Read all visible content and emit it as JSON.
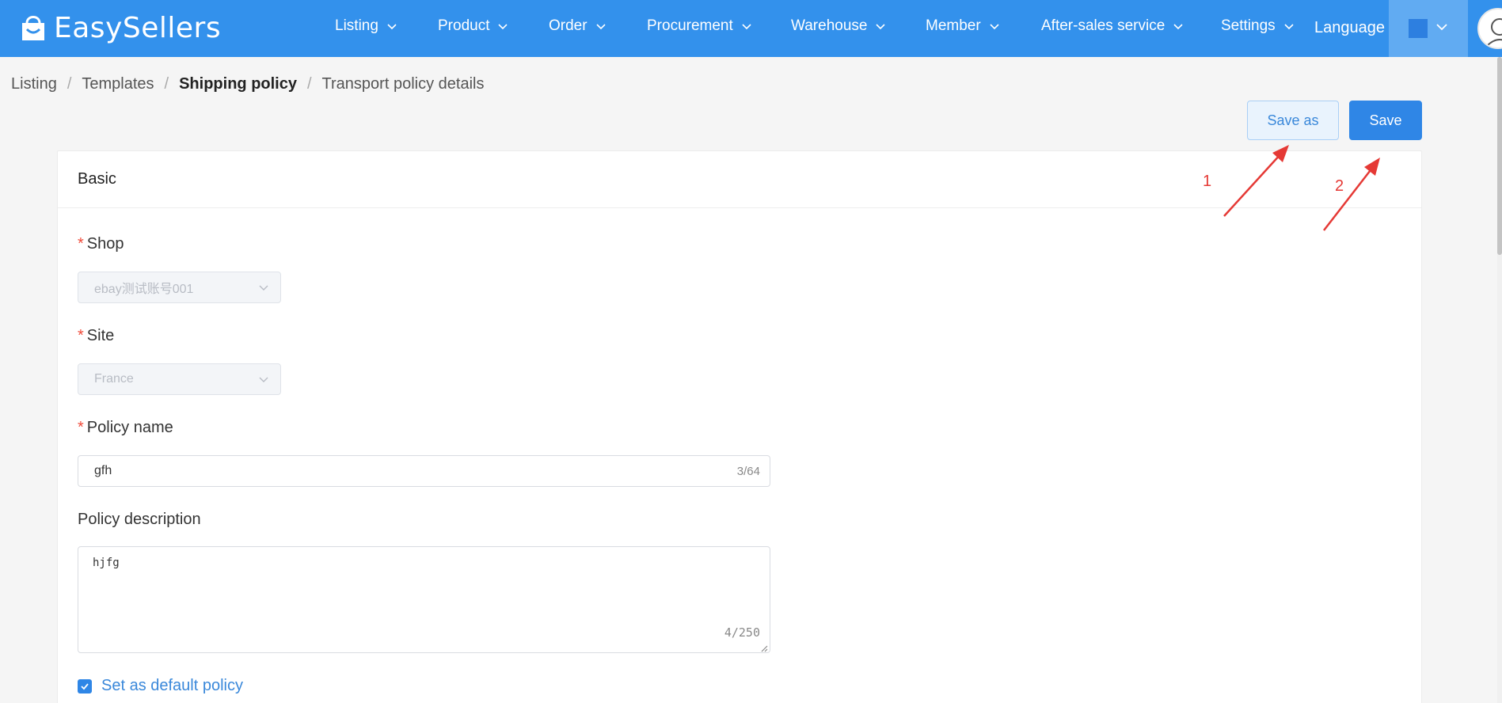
{
  "app": {
    "name": "EasySellers"
  },
  "nav": {
    "items": [
      {
        "label": "Listing"
      },
      {
        "label": "Product"
      },
      {
        "label": "Order"
      },
      {
        "label": "Procurement"
      },
      {
        "label": "Warehouse"
      },
      {
        "label": "Member"
      },
      {
        "label": "After-sales service"
      },
      {
        "label": "Settings"
      }
    ],
    "language": "Language"
  },
  "breadcrumb": [
    "Listing",
    "Templates",
    "Shipping policy",
    "Transport policy details"
  ],
  "actions": {
    "save_as": "Save as",
    "save": "Save"
  },
  "card": {
    "title": "Basic",
    "shop": {
      "label": "Shop",
      "value": "ebay测试账号001"
    },
    "site": {
      "label": "Site",
      "value": "France"
    },
    "policy_name": {
      "label": "Policy name",
      "value": "gfh",
      "count": "3/64"
    },
    "policy_description": {
      "label": "Policy description",
      "value": "hjfg",
      "count": "4/250"
    },
    "default_policy": {
      "label": "Set as default policy",
      "checked": true
    }
  },
  "annotations": {
    "first": "1",
    "second": "2"
  },
  "colors": {
    "primary": "#3391ec",
    "annotation": "#e53935"
  }
}
